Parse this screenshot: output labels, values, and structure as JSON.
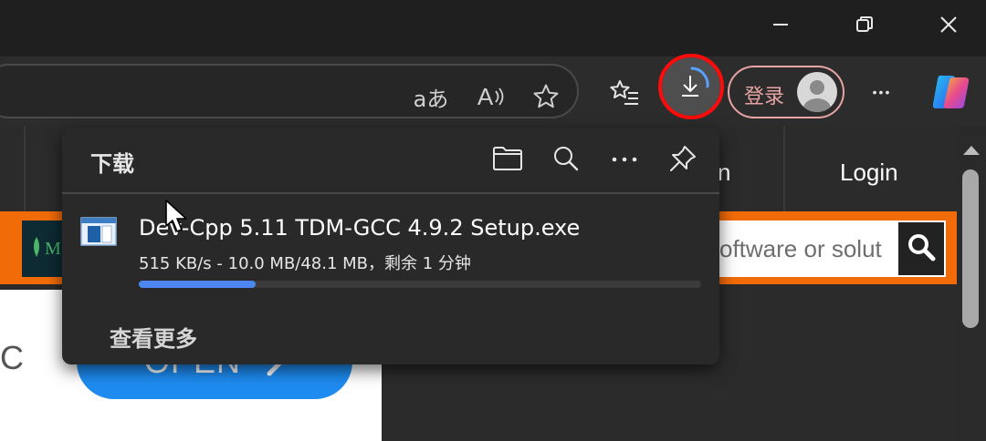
{
  "window": {
    "minimize_icon": "minimize-icon",
    "restore_icon": "restore-icon",
    "close_icon": "close-icon"
  },
  "toolbar": {
    "translate_glyph": "aあ",
    "read_aloud_glyph": "A",
    "login_label": "登录",
    "more_glyph": "•••"
  },
  "page": {
    "nav_partial": "n",
    "nav_login": "Login",
    "logo_partial": "M",
    "search_placeholder": "oftware or solut",
    "c_letter": "C",
    "open_label": "OPEN"
  },
  "downloads": {
    "title": "下载",
    "item": {
      "filename": "Dev-Cpp 5.11 TDM-GCC 4.9.2 Setup.exe",
      "status": "515 KB/s - 10.0 MB/48.1 MB，剩余 1 分钟",
      "progress": 0.208
    },
    "see_more": "查看更多"
  },
  "colors": {
    "accent": "#4d86f0",
    "highlight_ring": "#ff0b0b",
    "orange_bar": "#f26b09",
    "open_button": "#1e8bf0",
    "login_border": "#e8a4a4"
  }
}
